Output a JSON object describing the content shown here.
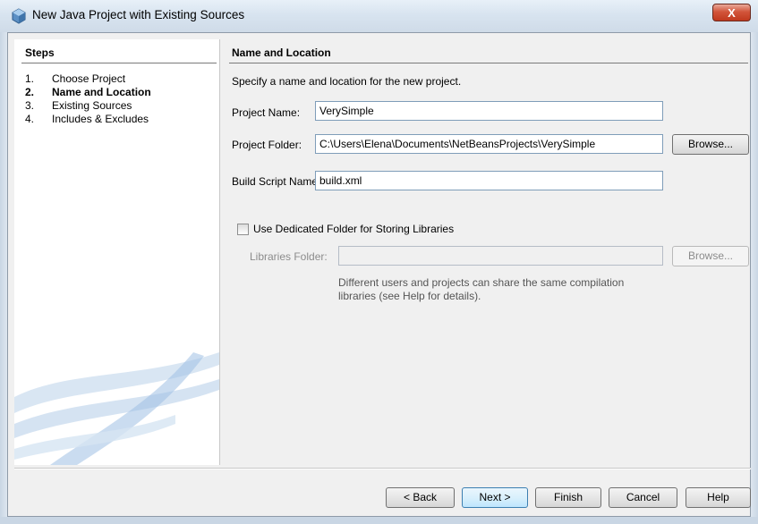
{
  "window": {
    "title": "New Java Project with Existing Sources",
    "close_label": "X"
  },
  "steps": {
    "title": "Steps",
    "items": [
      {
        "num": "1.",
        "label": "Choose Project"
      },
      {
        "num": "2.",
        "label": "Name and Location"
      },
      {
        "num": "3.",
        "label": "Existing Sources"
      },
      {
        "num": "4.",
        "label": "Includes & Excludes"
      }
    ],
    "current_index": 1
  },
  "main": {
    "section_title": "Name and Location",
    "description": "Specify a name and location for the new project.",
    "project_name": {
      "label": "Project Name:",
      "value": "VerySimple"
    },
    "project_folder": {
      "label": "Project Folder:",
      "value": "C:\\Users\\Elena\\Documents\\NetBeansProjects\\VerySimple"
    },
    "browse_label": "Browse...",
    "build_script": {
      "label": "Build Script Name:",
      "value": "build.xml"
    },
    "dedicated_folder": {
      "label": "Use Dedicated Folder for Storing Libraries",
      "checked": false
    },
    "libraries_folder": {
      "label": "Libraries Folder:",
      "value": ""
    },
    "libraries_browse_label": "Browse...",
    "hint": "Different users and projects can share the same compilation libraries (see Help for details)."
  },
  "footer": {
    "back_label": "< Back",
    "next_label": "Next >",
    "finish_label": "Finish",
    "cancel_label": "Cancel",
    "help_label": "Help"
  },
  "colors": {
    "close_button": "#c0391e",
    "field_border": "#7f9db9",
    "default_button_border": "#3c7fb1"
  }
}
